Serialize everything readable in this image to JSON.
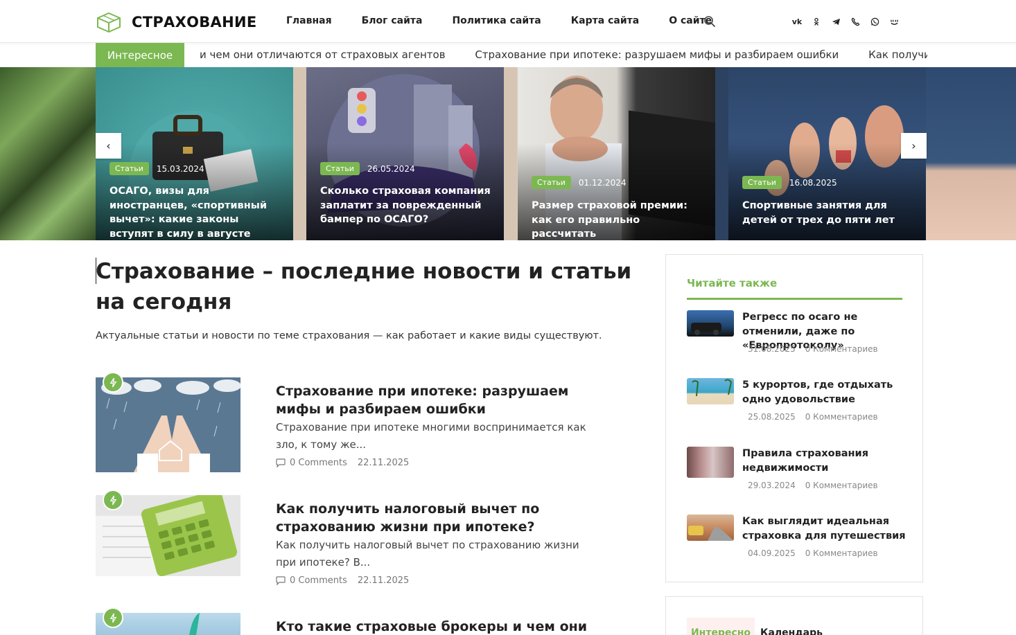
{
  "header": {
    "logo_text": "СТРАХОВАНИЕ",
    "nav": [
      "Главная",
      "Блог сайта",
      "Политика сайта",
      "Карта сайта",
      "О сайте"
    ],
    "socials": [
      "vk-icon",
      "odnoklassniki-icon",
      "telegram-icon",
      "viber-icon",
      "whatsapp-icon",
      "moimir-icon"
    ]
  },
  "ticker": {
    "label": "Интересное",
    "items": [
      "и чем они отличаются от страховых агентов",
      "Страхование при ипотеке: разрушаем мифы и разбираем ошибки",
      "Как получить налого"
    ]
  },
  "slider": {
    "cards": [
      {
        "badge": "Статьи",
        "date": "15.03.2024",
        "title": "ОСАГО, визы для иностранцев, «спортивный вычет»: какие законы вступят в силу в августе"
      },
      {
        "badge": "Статьи",
        "date": "26.05.2024",
        "title": "Сколько страховая компания заплатит за поврежденный бампер по ОСАГО?"
      },
      {
        "badge": "Статьи",
        "date": "01.12.2024",
        "title": "Размер страховой премии: как его правильно рассчитать"
      },
      {
        "badge": "Статьи",
        "date": "16.08.2025",
        "title": "Спортивные занятия для детей от трех до пяти лет"
      }
    ],
    "prev_label": "‹",
    "next_label": "›"
  },
  "main": {
    "title": "Страхование – последние новости и статьи на сегодня",
    "description": "Актуальные статьи и новости по теме страхования — как работает и какие виды существуют.",
    "posts": [
      {
        "title": "Страхование при ипотеке: разрушаем мифы и разбираем ошибки",
        "excerpt": "Страхование при ипотеке многими воспринимается как зло, к тому же...",
        "comments": "0 Comments",
        "date": "22.11.2025"
      },
      {
        "title": "Как получить налоговый вычет по страхованию жизни при ипотеке?",
        "excerpt": "Как получить налоговый вычет по страхованию жизни при ипотеке? В...",
        "comments": "0 Comments",
        "date": "22.11.2025"
      },
      {
        "title": "Кто такие страховые брокеры и чем они",
        "excerpt": "",
        "comments": "",
        "date": ""
      }
    ]
  },
  "sidebar": {
    "widget_title": "Читайте также",
    "items": [
      {
        "title": "Регресс по осаго не отменили, даже по «Европротоколу»",
        "date": "31.08.2025",
        "comments": "0 Комментариев"
      },
      {
        "title": "5 курортов, где отдыхать одно удовольствие",
        "date": "25.08.2025",
        "comments": "0 Комментариев"
      },
      {
        "title": "Правила страхования недвижимости",
        "date": "29.03.2024",
        "comments": "0 Комментариев"
      },
      {
        "title": "Как выглядит идеальная страховка для путешествия",
        "date": "04.09.2025",
        "comments": "0 Комментариев"
      }
    ],
    "widget2_tab1": "Интересно",
    "widget2_tab2": "Календарь"
  },
  "colors": {
    "accent": "#7cb852"
  }
}
